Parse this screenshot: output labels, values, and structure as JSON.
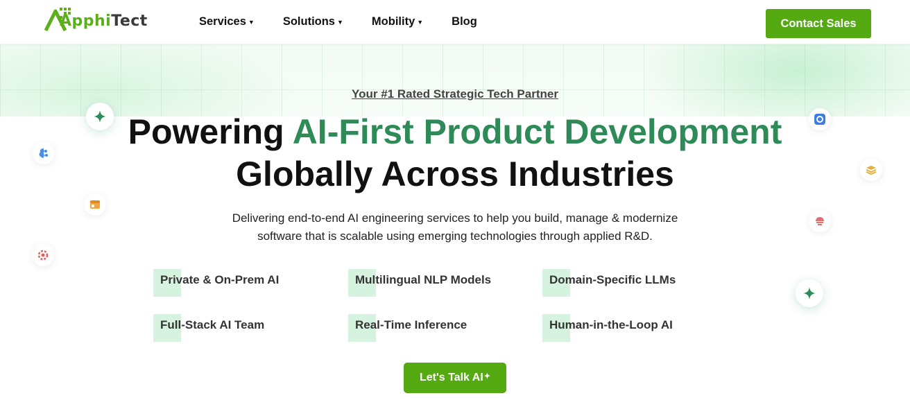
{
  "brand": {
    "logo_part1": "Apphi",
    "logo_part2": "Tect"
  },
  "nav": {
    "items": [
      {
        "label": "Services",
        "has_dropdown": true
      },
      {
        "label": "Solutions",
        "has_dropdown": true
      },
      {
        "label": "Mobility",
        "has_dropdown": true
      },
      {
        "label": "Blog",
        "has_dropdown": false
      }
    ],
    "contact_label": "Contact Sales"
  },
  "hero": {
    "eyebrow": "Your #1 Rated Strategic Tech Partner",
    "headline_part1": "Powering ",
    "headline_highlight": "AI-First Product Development",
    "headline_part2": "Globally Across Industries",
    "subtitle_line1": "Delivering end-to-end AI engineering services to help you build, manage & modernize",
    "subtitle_line2": "software that is scalable using emerging technologies through applied R&D.",
    "features": [
      "Private & On-Prem AI",
      "Multilingual NLP Models",
      "Domain-Specific LLMs",
      "Full-Stack AI Team",
      "Real-Time Inference",
      "Human-in-the-Loop AI"
    ],
    "cta_label": "Let's Talk AI",
    "cta_sparkle": "✦"
  },
  "colors": {
    "brand_green": "#55aa12",
    "headline_green": "#2e8b57",
    "feature_mark": "#d6f3df"
  },
  "icons": [
    "sparkle-icon",
    "brain-icon",
    "window-icon",
    "gear-icon",
    "settings-icon",
    "database-icon",
    "cloud-icon",
    "sparkle-icon"
  ]
}
